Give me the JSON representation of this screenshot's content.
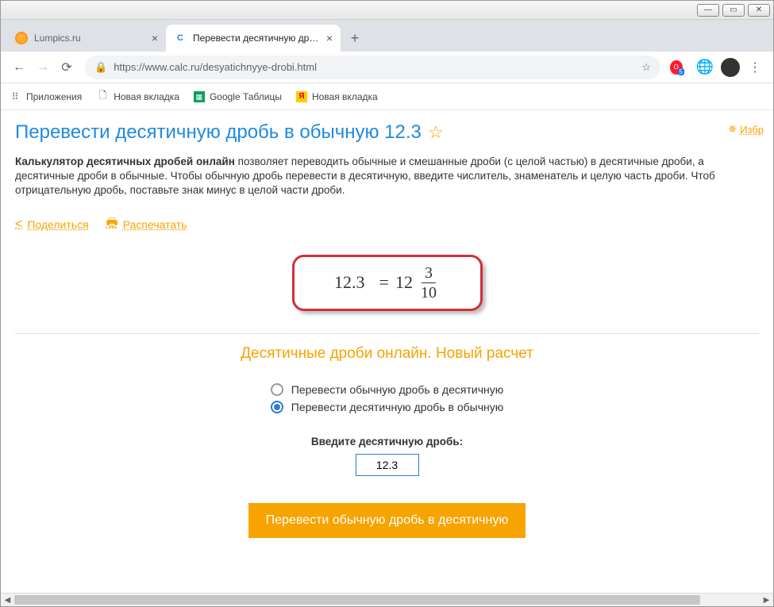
{
  "tabs": [
    {
      "label": "Lumpics.ru"
    },
    {
      "label": "Перевести десятичную дробь в"
    }
  ],
  "addr": {
    "url_prefix": "https://",
    "url_host": "www.calc.ru",
    "url_path": "/desyatichnyye-drobi.html"
  },
  "bookmarks": {
    "apps": "Приложения",
    "b1": "Новая вкладка",
    "b2": "Google Таблицы",
    "b3": "Новая вкладка"
  },
  "page": {
    "title": "Перевести десятичную дробь в обычную 12.3",
    "fav": "Избр",
    "desc_bold": "Калькулятор десятичных дробей онлайн",
    "desc_rest": " позволяет переводить обычные и смешанные дроби (с целой частью) в десятичные дроби, а десятичные дроби в обычные. Чтобы обычную дробь перевести в десятичную, введите числитель, знаменатель и целую часть дроби. Чтоб отрицательную дробь, поставьте знак минус в целой части дроби.",
    "share": "Поделиться",
    "print": "Распечатать",
    "result": {
      "decimal": "12.3",
      "equals": "=",
      "whole": "12",
      "num": "3",
      "den": "10"
    },
    "sect_title": "Десятичные дроби онлайн. Новый расчет",
    "radio1": "Перевести обычную дробь в десятичную",
    "radio2": "Перевести десятичную дробь в обычную",
    "input_label": "Введите десятичную дробь:",
    "input_value": "12.3",
    "button": "Перевести обычную дробь в десятичную"
  }
}
